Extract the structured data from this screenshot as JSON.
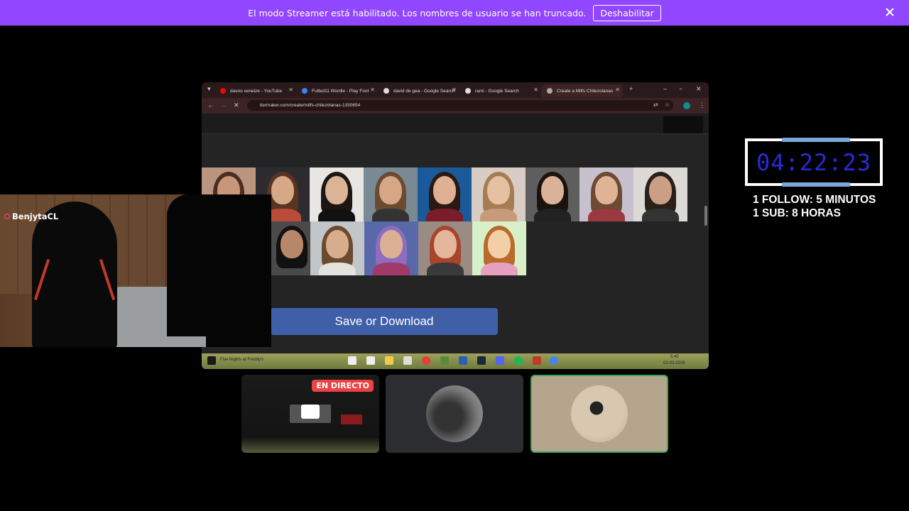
{
  "banner": {
    "message": "El modo Streamer está habilitado. Los nombres de usuario se han truncado.",
    "disable_label": "Deshabilitar"
  },
  "browser": {
    "tabs": [
      {
        "label": "davoo xeneize - YouTube",
        "favicon_color": "#ff0000"
      },
      {
        "label": "Futbol11 Wordle - Play Foot",
        "favicon_color": "#3b82f6"
      },
      {
        "label": "david de gea - Google Search",
        "favicon_color": "#dddddd"
      },
      {
        "label": "rami - Google Search",
        "favicon_color": "#dddddd"
      },
      {
        "label": "Create a Milfs Chilezolanas",
        "favicon_color": "#aaaaaa"
      }
    ],
    "url": "tiermaker.com/create/milfs-chilezolanas-1330654"
  },
  "page": {
    "save_label": "Save or Download"
  },
  "taskbar": {
    "search_text": "Five Nights at Freddy's",
    "time": "5:45",
    "date": "02-03-2026"
  },
  "webcam": {
    "username": "BenjytaCL"
  },
  "timer": {
    "value": "04:22:23",
    "digit_color": "#2a2ad8"
  },
  "rules": {
    "line1": "1 FOLLOW: 5 MINUTOS",
    "line2": "1 SUB: 8 HORAS"
  },
  "participants": {
    "live_label": "EN DIRECTO"
  },
  "colors": {
    "banner": "#9146ff",
    "live_badge": "#ed4245",
    "speaking_border": "#3ba55c"
  }
}
